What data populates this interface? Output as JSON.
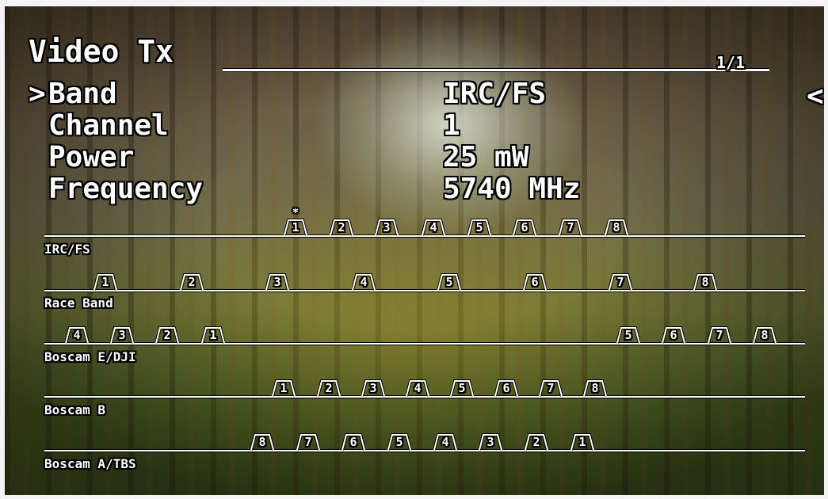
{
  "menu": {
    "title": "Video Tx",
    "page": "1/1",
    "selector": ">",
    "back_arrow": "<",
    "rows": [
      {
        "label": "Band",
        "value": "IRC/FS"
      },
      {
        "label": "Channel",
        "value": "1"
      },
      {
        "label": "Power",
        "value": "25 mW"
      },
      {
        "label": "Frequency",
        "value": "5740 MHz"
      }
    ]
  },
  "bands": [
    {
      "name": "IRC/FS",
      "selected_channel": "1",
      "selected_marker": "*",
      "channels": [
        "1",
        "2",
        "3",
        "4",
        "5",
        "6",
        "7",
        "8"
      ]
    },
    {
      "name": "Race Band",
      "channels": [
        "1",
        "2",
        "3",
        "4",
        "5",
        "6",
        "7",
        "8"
      ]
    },
    {
      "name": "Boscam E/DJI",
      "channels": [
        "4",
        "3",
        "2",
        "1",
        "5",
        "6",
        "7",
        "8"
      ]
    },
    {
      "name": "Boscam B",
      "channels": [
        "1",
        "2",
        "3",
        "4",
        "5",
        "6",
        "7",
        "8"
      ]
    },
    {
      "name": "Boscam A/TBS",
      "channels": [
        "8",
        "7",
        "6",
        "5",
        "4",
        "3",
        "2",
        "1"
      ]
    }
  ]
}
